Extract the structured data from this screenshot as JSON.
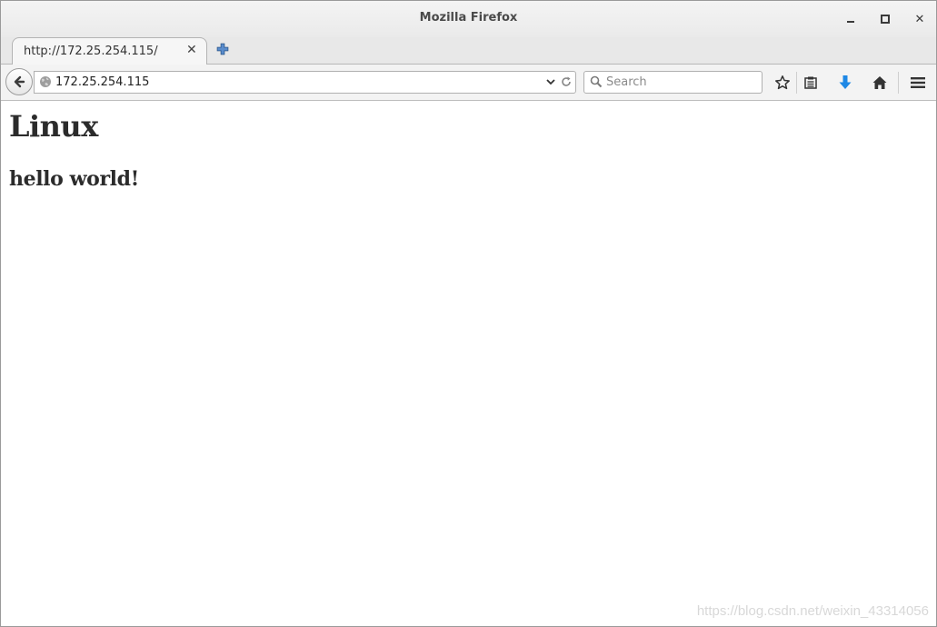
{
  "window": {
    "title": "Mozilla Firefox"
  },
  "tabs": [
    {
      "label": "http://172.25.254.115/",
      "active": true
    }
  ],
  "navbar": {
    "url": "172.25.254.115",
    "search_placeholder": "Search"
  },
  "icons": {
    "back": "back-arrow-icon",
    "site": "globe-icon",
    "dropdown": "chevron-down-icon",
    "reload": "reload-icon",
    "search": "search-icon",
    "bookmark": "star-icon",
    "reading_list": "clipboard-icon",
    "downloads": "download-arrow-icon",
    "home": "home-icon",
    "menu": "hamburger-menu-icon"
  },
  "colors": {
    "download_accent": "#1e88e5",
    "text_dark": "#2b2b2b"
  },
  "page": {
    "heading1": "Linux",
    "heading2": "hello world!"
  },
  "watermark": "https://blog.csdn.net/weixin_43314056"
}
